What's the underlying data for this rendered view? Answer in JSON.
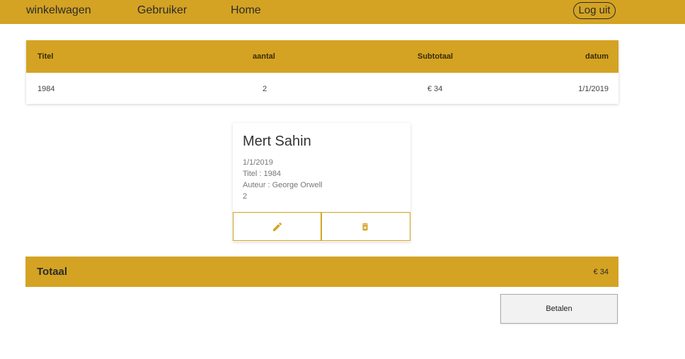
{
  "nav": {
    "cart": "winkelwagen",
    "user": "Gebruiker",
    "home": "Home",
    "logout": "Log uit"
  },
  "table": {
    "headers": [
      "Titel",
      "aantal",
      "Subtotaal",
      "datum"
    ],
    "rows": [
      {
        "titel": "1984",
        "aantal": "2",
        "subtotaal": "€ 34",
        "datum": "1/1/2019"
      }
    ]
  },
  "card": {
    "name": "Mert Sahin",
    "date": "1/1/2019",
    "title": "Titel : 1984",
    "author": "Auteur : George Orwell",
    "quantity": "2",
    "icons": [
      "pencil-icon",
      "trash-icon"
    ]
  },
  "total": {
    "label": "Totaal",
    "value": "€ 34"
  },
  "pay_label": "Betalen",
  "colors": {
    "accent": "#d4a323",
    "text": "#333333"
  }
}
